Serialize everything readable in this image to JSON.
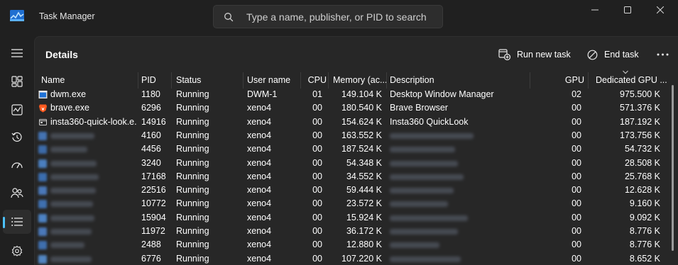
{
  "window": {
    "title": "Task Manager",
    "search_placeholder": "Type a name, publisher, or PID to search"
  },
  "page": {
    "title": "Details",
    "run_new_task": "Run new task",
    "end_task": "End task"
  },
  "columns": {
    "name": "Name",
    "pid": "PID",
    "status": "Status",
    "user": "User name",
    "cpu": "CPU",
    "memory": "Memory (ac...",
    "description": "Description",
    "gpu": "GPU",
    "dedicated_gpu": "Dedicated GPU ..."
  },
  "rows": [
    {
      "name": "dwm.exe",
      "pid": "1180",
      "status": "Running",
      "user": "DWM-1",
      "cpu": "01",
      "memory": "149.104 K",
      "description": "Desktop Window Manager",
      "gpu": "02",
      "dgpu": "975.500 K",
      "icon": "dwm-window-icon"
    },
    {
      "name": "brave.exe",
      "pid": "6296",
      "status": "Running",
      "user": "xeno4",
      "cpu": "00",
      "memory": "180.540 K",
      "description": "Brave Browser",
      "gpu": "00",
      "dgpu": "571.376 K",
      "icon": "brave-lion-icon"
    },
    {
      "name": "insta360-quick-look.e...",
      "pid": "14916",
      "status": "Running",
      "user": "xeno4",
      "cpu": "00",
      "memory": "154.624 K",
      "description": "Insta360 QuickLook",
      "gpu": "00",
      "dgpu": "187.192 K",
      "icon": "insta360-icon"
    },
    {
      "pid": "4160",
      "status": "Running",
      "user": "xeno4",
      "cpu": "00",
      "memory": "163.552 K",
      "gpu": "00",
      "dgpu": "173.756 K"
    },
    {
      "pid": "4456",
      "status": "Running",
      "user": "xeno4",
      "cpu": "00",
      "memory": "187.524 K",
      "gpu": "00",
      "dgpu": "54.732 K"
    },
    {
      "pid": "3240",
      "status": "Running",
      "user": "xeno4",
      "cpu": "00",
      "memory": "54.348 K",
      "gpu": "00",
      "dgpu": "28.508 K"
    },
    {
      "pid": "17168",
      "status": "Running",
      "user": "xeno4",
      "cpu": "00",
      "memory": "34.552 K",
      "gpu": "00",
      "dgpu": "25.768 K"
    },
    {
      "pid": "22516",
      "status": "Running",
      "user": "xeno4",
      "cpu": "00",
      "memory": "59.444 K",
      "gpu": "00",
      "dgpu": "12.628 K"
    },
    {
      "pid": "10772",
      "status": "Running",
      "user": "xeno4",
      "cpu": "00",
      "memory": "23.572 K",
      "gpu": "00",
      "dgpu": "9.160 K"
    },
    {
      "pid": "15904",
      "status": "Running",
      "user": "xeno4",
      "cpu": "00",
      "memory": "15.924 K",
      "gpu": "00",
      "dgpu": "9.092 K"
    },
    {
      "pid": "11972",
      "status": "Running",
      "user": "xeno4",
      "cpu": "00",
      "memory": "36.172 K",
      "gpu": "00",
      "dgpu": "8.776 K"
    },
    {
      "pid": "2488",
      "status": "Running",
      "user": "xeno4",
      "cpu": "00",
      "memory": "12.880 K",
      "gpu": "00",
      "dgpu": "8.776 K"
    },
    {
      "pid": "6776",
      "status": "Running",
      "user": "xeno4",
      "cpu": "00",
      "memory": "107.220 K",
      "gpu": "00",
      "dgpu": "8.652 K"
    }
  ],
  "nav": {
    "items": [
      {
        "icon": "hamburger-menu-icon"
      },
      {
        "icon": "processes-icon"
      },
      {
        "icon": "performance-icon"
      },
      {
        "icon": "app-history-icon"
      },
      {
        "icon": "startup-apps-icon"
      },
      {
        "icon": "users-icon"
      },
      {
        "icon": "details-icon",
        "active": true
      },
      {
        "icon": "services-icon"
      }
    ]
  },
  "colors": {
    "background": "#202020",
    "panel": "#272727",
    "accent": "#4cc2ff",
    "text": "#ffffff"
  }
}
